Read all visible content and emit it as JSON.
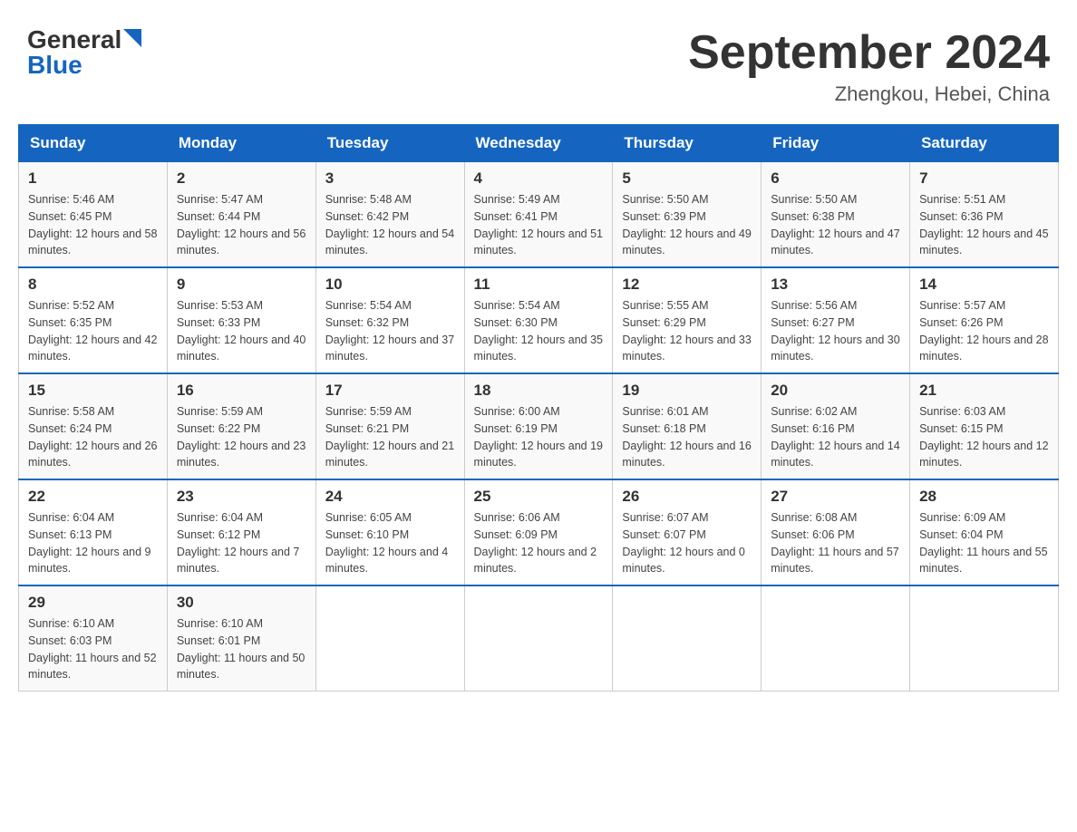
{
  "header": {
    "logo_general": "General",
    "logo_blue": "Blue",
    "title": "September 2024",
    "subtitle": "Zhengkou, Hebei, China"
  },
  "days_of_week": [
    "Sunday",
    "Monday",
    "Tuesday",
    "Wednesday",
    "Thursday",
    "Friday",
    "Saturday"
  ],
  "weeks": [
    [
      {
        "day": "1",
        "sunrise": "5:46 AM",
        "sunset": "6:45 PM",
        "daylight": "12 hours and 58 minutes."
      },
      {
        "day": "2",
        "sunrise": "5:47 AM",
        "sunset": "6:44 PM",
        "daylight": "12 hours and 56 minutes."
      },
      {
        "day": "3",
        "sunrise": "5:48 AM",
        "sunset": "6:42 PM",
        "daylight": "12 hours and 54 minutes."
      },
      {
        "day": "4",
        "sunrise": "5:49 AM",
        "sunset": "6:41 PM",
        "daylight": "12 hours and 51 minutes."
      },
      {
        "day": "5",
        "sunrise": "5:50 AM",
        "sunset": "6:39 PM",
        "daylight": "12 hours and 49 minutes."
      },
      {
        "day": "6",
        "sunrise": "5:50 AM",
        "sunset": "6:38 PM",
        "daylight": "12 hours and 47 minutes."
      },
      {
        "day": "7",
        "sunrise": "5:51 AM",
        "sunset": "6:36 PM",
        "daylight": "12 hours and 45 minutes."
      }
    ],
    [
      {
        "day": "8",
        "sunrise": "5:52 AM",
        "sunset": "6:35 PM",
        "daylight": "12 hours and 42 minutes."
      },
      {
        "day": "9",
        "sunrise": "5:53 AM",
        "sunset": "6:33 PM",
        "daylight": "12 hours and 40 minutes."
      },
      {
        "day": "10",
        "sunrise": "5:54 AM",
        "sunset": "6:32 PM",
        "daylight": "12 hours and 37 minutes."
      },
      {
        "day": "11",
        "sunrise": "5:54 AM",
        "sunset": "6:30 PM",
        "daylight": "12 hours and 35 minutes."
      },
      {
        "day": "12",
        "sunrise": "5:55 AM",
        "sunset": "6:29 PM",
        "daylight": "12 hours and 33 minutes."
      },
      {
        "day": "13",
        "sunrise": "5:56 AM",
        "sunset": "6:27 PM",
        "daylight": "12 hours and 30 minutes."
      },
      {
        "day": "14",
        "sunrise": "5:57 AM",
        "sunset": "6:26 PM",
        "daylight": "12 hours and 28 minutes."
      }
    ],
    [
      {
        "day": "15",
        "sunrise": "5:58 AM",
        "sunset": "6:24 PM",
        "daylight": "12 hours and 26 minutes."
      },
      {
        "day": "16",
        "sunrise": "5:59 AM",
        "sunset": "6:22 PM",
        "daylight": "12 hours and 23 minutes."
      },
      {
        "day": "17",
        "sunrise": "5:59 AM",
        "sunset": "6:21 PM",
        "daylight": "12 hours and 21 minutes."
      },
      {
        "day": "18",
        "sunrise": "6:00 AM",
        "sunset": "6:19 PM",
        "daylight": "12 hours and 19 minutes."
      },
      {
        "day": "19",
        "sunrise": "6:01 AM",
        "sunset": "6:18 PM",
        "daylight": "12 hours and 16 minutes."
      },
      {
        "day": "20",
        "sunrise": "6:02 AM",
        "sunset": "6:16 PM",
        "daylight": "12 hours and 14 minutes."
      },
      {
        "day": "21",
        "sunrise": "6:03 AM",
        "sunset": "6:15 PM",
        "daylight": "12 hours and 12 minutes."
      }
    ],
    [
      {
        "day": "22",
        "sunrise": "6:04 AM",
        "sunset": "6:13 PM",
        "daylight": "12 hours and 9 minutes."
      },
      {
        "day": "23",
        "sunrise": "6:04 AM",
        "sunset": "6:12 PM",
        "daylight": "12 hours and 7 minutes."
      },
      {
        "day": "24",
        "sunrise": "6:05 AM",
        "sunset": "6:10 PM",
        "daylight": "12 hours and 4 minutes."
      },
      {
        "day": "25",
        "sunrise": "6:06 AM",
        "sunset": "6:09 PM",
        "daylight": "12 hours and 2 minutes."
      },
      {
        "day": "26",
        "sunrise": "6:07 AM",
        "sunset": "6:07 PM",
        "daylight": "12 hours and 0 minutes."
      },
      {
        "day": "27",
        "sunrise": "6:08 AM",
        "sunset": "6:06 PM",
        "daylight": "11 hours and 57 minutes."
      },
      {
        "day": "28",
        "sunrise": "6:09 AM",
        "sunset": "6:04 PM",
        "daylight": "11 hours and 55 minutes."
      }
    ],
    [
      {
        "day": "29",
        "sunrise": "6:10 AM",
        "sunset": "6:03 PM",
        "daylight": "11 hours and 52 minutes."
      },
      {
        "day": "30",
        "sunrise": "6:10 AM",
        "sunset": "6:01 PM",
        "daylight": "11 hours and 50 minutes."
      },
      null,
      null,
      null,
      null,
      null
    ]
  ]
}
